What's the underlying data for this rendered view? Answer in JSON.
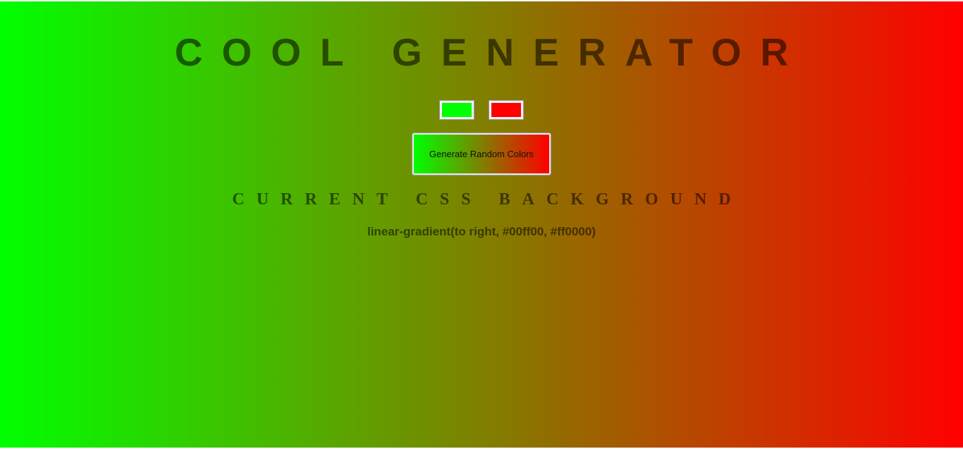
{
  "header": {
    "title": "COOL GENERATOR"
  },
  "pickers": {
    "color1": "#00ff00",
    "color2": "#ff0000"
  },
  "generate_button": {
    "label": "Generate Random Colors"
  },
  "current": {
    "heading": "CURRENT CSS BACKGROUND",
    "value": "linear-gradient(to right, #00ff00, #ff0000)"
  }
}
